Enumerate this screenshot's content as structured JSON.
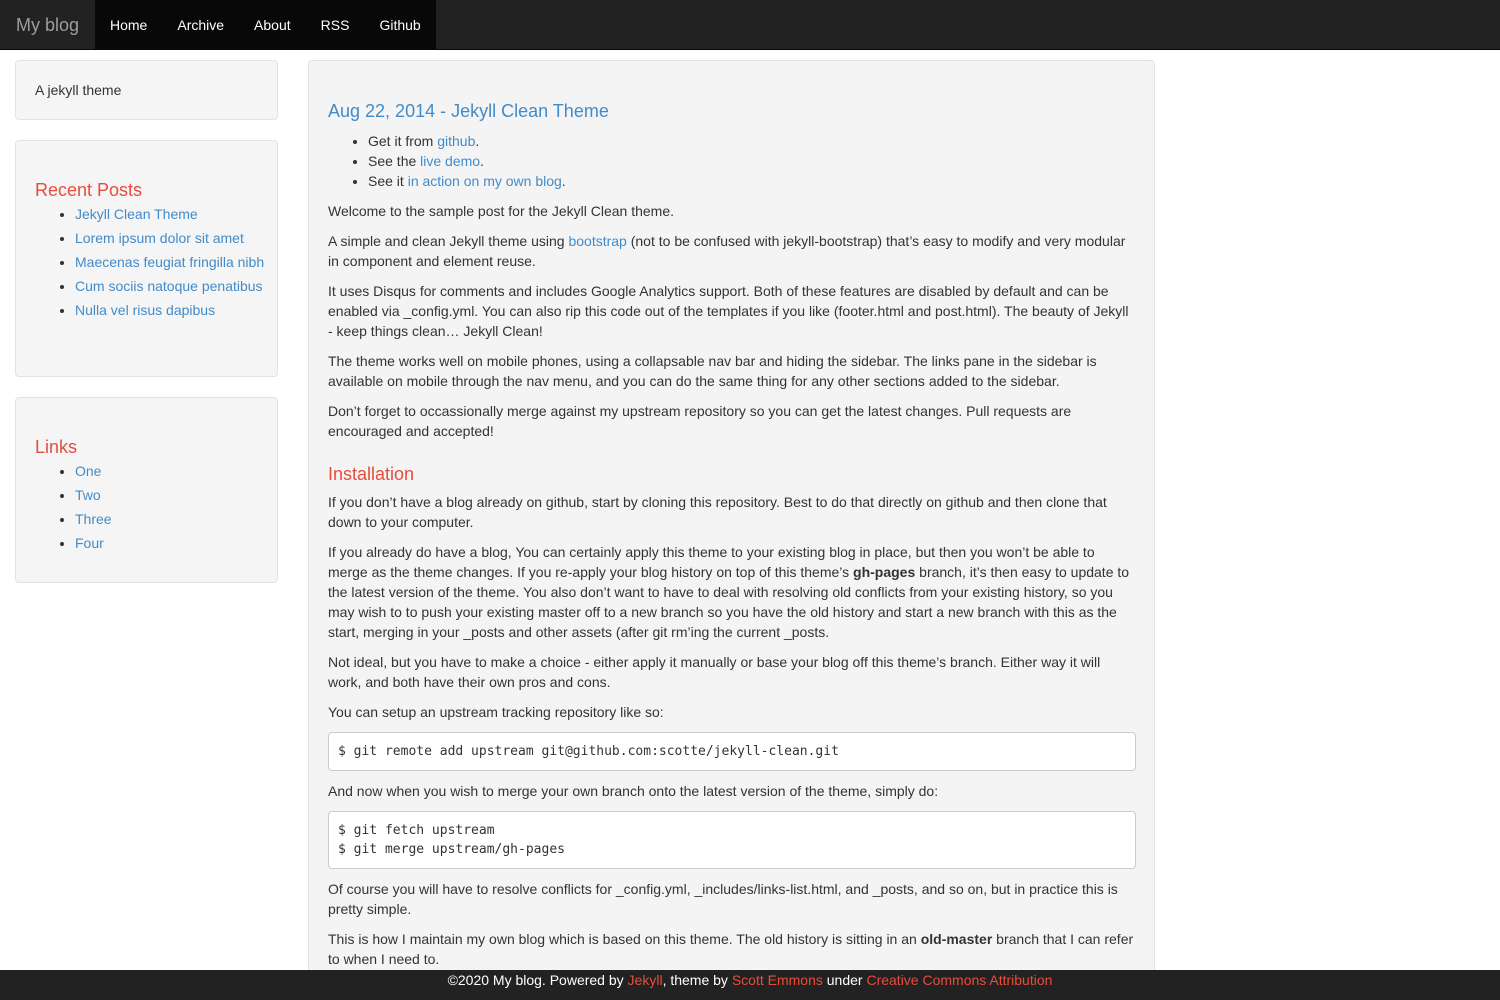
{
  "navbar": {
    "brand": "My blog",
    "links": [
      "Home",
      "Archive",
      "About",
      "RSS",
      "Github"
    ]
  },
  "sidebar": {
    "tagline": "A jekyll theme",
    "recent": {
      "title": "Recent Posts",
      "items": [
        "Jekyll Clean Theme",
        "Lorem ipsum dolor sit amet",
        "Maecenas feugiat fringilla nibh",
        "Cum sociis natoque penatibus",
        "Nulla vel risus dapibus"
      ]
    },
    "links": {
      "title": "Links",
      "items": [
        "One",
        "Two",
        "Three",
        "Four"
      ]
    }
  },
  "post": {
    "title": "Aug 22, 2014 - Jekyll Clean Theme",
    "bullets": [
      {
        "pre": "Get it from ",
        "link": "github",
        "post": "."
      },
      {
        "pre": "See the ",
        "link": "live demo",
        "post": "."
      },
      {
        "pre": "See it ",
        "link": "in action on my own blog",
        "post": "."
      }
    ],
    "p1": "Welcome to the sample post for the Jekyll Clean theme.",
    "p2_pre": "A simple and clean Jekyll theme using ",
    "p2_link": "bootstrap",
    "p2_post": " (not to be confused with jekyll-bootstrap) that’s easy to modify and very modular in component and element reuse.",
    "p3": "It uses Disqus for comments and includes Google Analytics support. Both of these features are disabled by default and can be enabled via _config.yml. You can also rip this code out of the templates if you like (footer.html and post.html). The beauty of Jekyll - keep things clean… Jekyll Clean!",
    "p4": "The theme works well on mobile phones, using a collapsable nav bar and hiding the sidebar. The links pane in the sidebar is available on mobile through the nav menu, and you can do the same thing for any other sections added to the sidebar.",
    "p5": "Don’t forget to occassionally merge against my upstream repository so you can get the latest changes. Pull requests are encouraged and accepted!",
    "install_heading": "Installation",
    "p6": "If you don’t have a blog already on github, start by cloning this repository. Best to do that directly on github and then clone that down to your computer.",
    "p7_a": "If you already do have a blog, You can certainly apply this theme to your existing blog in place, but then you won’t be able to merge as the theme changes. If you re-apply your blog history on top of this theme’s ",
    "p7_bold": "gh-pages",
    "p7_b": " branch, it’s then easy to update to the latest version of the theme. You also don’t want to have to deal with resolving old conflicts from your existing history, so you may wish to to push your existing master off to a new branch so you have the old history and start a new branch with this as the start, merging in your _posts and other assets (after git rm’ing the current _posts.",
    "p8": "Not ideal, but you have to make a choice - either apply it manually or base your blog off this theme’s branch. Either way it will work, and both have their own pros and cons.",
    "p9": "You can setup an upstream tracking repository like so:",
    "code1": "$ git remote add upstream git@github.com:scotte/jekyll-clean.git",
    "p10": "And now when you wish to merge your own branch onto the latest version of the theme, simply do:",
    "code2": "$ git fetch upstream\n$ git merge upstream/gh-pages",
    "p11": "Of course you will have to resolve conflicts for _config.yml, _includes/links-list.html, and _posts, and so on, but in practice this is pretty simple.",
    "p12_a": "This is how I maintain my own blog which is based on this theme. The old history is sitting in an ",
    "p12_bold": "old-master",
    "p12_b": " branch that I can refer to when I need to."
  },
  "footer": {
    "pre": "©2020 My blog. Powered by ",
    "jekyll": "Jekyll",
    "mid": ", theme by ",
    "author": "Scott Emmons",
    "under": " under ",
    "license": "Creative Commons Attribution"
  },
  "colors": {
    "navbar_bg": "#222222",
    "link": "#428bca",
    "accent_red": "#e74c3c",
    "panel_bg": "#f5f5f5"
  }
}
